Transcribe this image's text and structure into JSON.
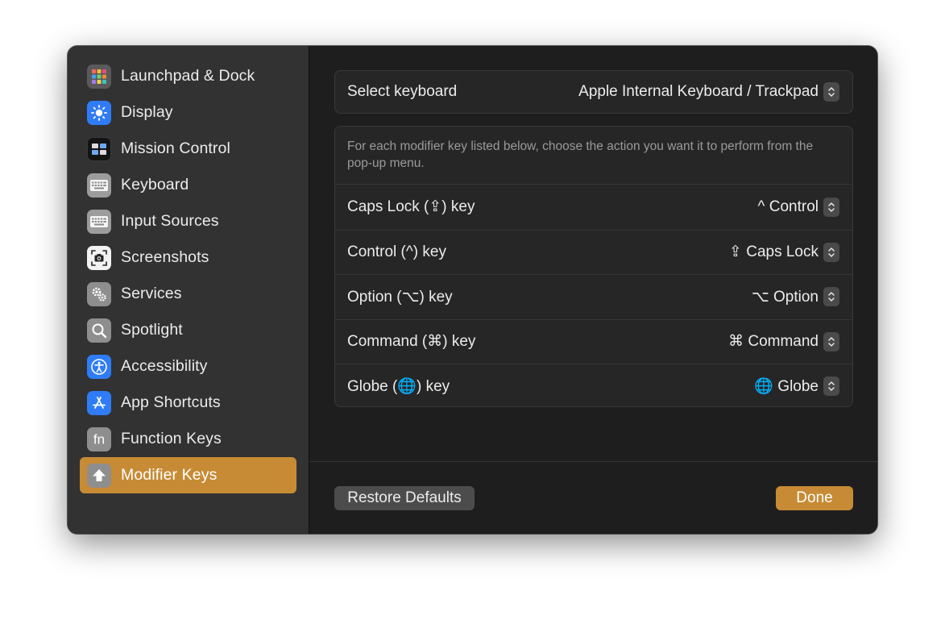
{
  "sidebar": {
    "items": [
      {
        "label": "Launchpad & Dock",
        "icon": "launchpad-icon"
      },
      {
        "label": "Display",
        "icon": "display-icon"
      },
      {
        "label": "Mission Control",
        "icon": "mission-control-icon"
      },
      {
        "label": "Keyboard",
        "icon": "keyboard-icon"
      },
      {
        "label": "Input Sources",
        "icon": "input-sources-icon"
      },
      {
        "label": "Screenshots",
        "icon": "screenshots-icon"
      },
      {
        "label": "Services",
        "icon": "services-icon"
      },
      {
        "label": "Spotlight",
        "icon": "spotlight-icon"
      },
      {
        "label": "Accessibility",
        "icon": "accessibility-icon"
      },
      {
        "label": "App Shortcuts",
        "icon": "app-shortcuts-icon"
      },
      {
        "label": "Function Keys",
        "icon": "function-keys-icon"
      },
      {
        "label": "Modifier Keys",
        "icon": "modifier-keys-icon",
        "selected": true
      }
    ]
  },
  "keyboard_select": {
    "label": "Select keyboard",
    "value": "Apple Internal Keyboard / Trackpad"
  },
  "modifiers": {
    "description": "For each modifier key listed below, choose the action you want it to perform from the pop-up menu.",
    "rows": [
      {
        "label": "Caps Lock (⇪) key",
        "value": "^ Control"
      },
      {
        "label": "Control (^) key",
        "value": "⇪ Caps Lock"
      },
      {
        "label": "Option (⌥) key",
        "value": "⌥ Option"
      },
      {
        "label": "Command (⌘) key",
        "value": "⌘ Command"
      },
      {
        "label": "Globe (🌐) key",
        "value": "🌐 Globe"
      }
    ]
  },
  "footer": {
    "restore_label": "Restore Defaults",
    "done_label": "Done"
  },
  "colors": {
    "accent": "#c78b35",
    "window_bg": "#1e1e1e",
    "sidebar_bg": "#323232"
  }
}
